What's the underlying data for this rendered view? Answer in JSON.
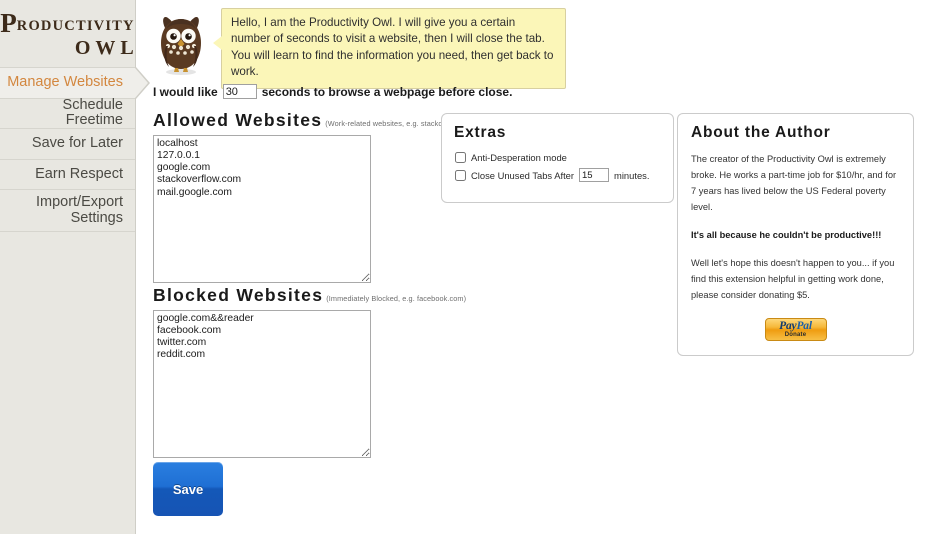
{
  "sidebar": {
    "logo": {
      "initial": "P",
      "rest": "RODUCTIVITY",
      "line2": "OWL"
    },
    "items": [
      {
        "label": "Manage Websites",
        "active": true
      },
      {
        "label": "Schedule Freetime",
        "active": false
      },
      {
        "label": "Save for Later",
        "active": false
      },
      {
        "label": "Earn Respect",
        "active": false
      },
      {
        "label": "Import/Export",
        "label2": "Settings",
        "active": false
      }
    ]
  },
  "owl": {
    "bubble_text": "Hello, I am the Productivity Owl. I will give you a certain number of seconds to visit a website, then I will close the tab. You will learn to find the information you need, then get back to work."
  },
  "seconds_row": {
    "prefix": "I would like",
    "value": "30",
    "suffix": "seconds to browse a webpage before close."
  },
  "allowed": {
    "title": "Allowed Websites",
    "subtitle": "(Work-related websites, e.g. stackoverflow.com)",
    "sites": "localhost\n127.0.0.1\ngoogle.com\nstackoverflow.com\nmail.google.com"
  },
  "blocked": {
    "title": "Blocked Websites",
    "subtitle": "(Immediately Blocked, e.g. facebook.com)",
    "sites": "google.com&&reader\nfacebook.com\ntwitter.com\nreddit.com"
  },
  "save_button": {
    "label": "Save"
  },
  "extras": {
    "title": "Extras",
    "anti_desperation_label": "Anti-Desperation mode",
    "anti_desperation_checked": false,
    "close_tabs_prefix": "Close Unused Tabs After",
    "close_tabs_value": "15",
    "close_tabs_suffix": "minutes.",
    "close_tabs_checked": false
  },
  "about": {
    "title": "About the Author",
    "p1": "The creator of the Productivity Owl is extremely broke. He works a part-time job for $10/hr, and for 7 years has lived below the US Federal poverty level.",
    "p2": "It's all because he couldn't be productive!!!",
    "p3": "Well let's hope this doesn't happen to you... if you find this extension helpful in getting work done, please consider donating $5.",
    "paypal_line1a": "Pay",
    "paypal_line1b": "Pal",
    "paypal_line2": "Donate"
  },
  "colors": {
    "sidebar_bg": "#e8e7e1",
    "accent_orange": "#d3873f",
    "logo_brown": "#3d2b1a",
    "bubble_yellow": "#fbf6b8",
    "save_blue": "#1f6fd4",
    "paypal_orange": "#f6b93b"
  }
}
